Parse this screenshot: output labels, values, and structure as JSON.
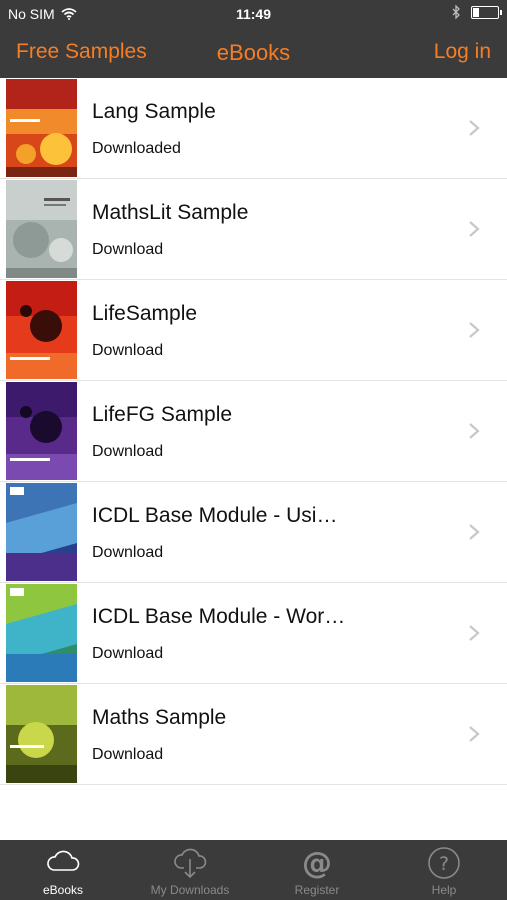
{
  "status_bar": {
    "carrier": "No SIM",
    "time": "11:49"
  },
  "nav": {
    "left_label": "Free Samples",
    "title": "eBooks",
    "right_label": "Log in"
  },
  "books": [
    {
      "title": "Lang Sample",
      "status": "Downloaded"
    },
    {
      "title": "MathsLit Sample",
      "status": "Download"
    },
    {
      "title": "LifeSample",
      "status": "Download"
    },
    {
      "title": "LifeFG Sample",
      "status": "Download"
    },
    {
      "title": "ICDL Base Module - Usi…",
      "status": "Download"
    },
    {
      "title": "ICDL Base Module - Wor…",
      "status": "Download"
    },
    {
      "title": "Maths Sample",
      "status": "Download"
    }
  ],
  "tabs": [
    {
      "label": "eBooks",
      "icon": "cloud-icon",
      "active": true
    },
    {
      "label": "My Downloads",
      "icon": "cloud-download-icon",
      "active": false
    },
    {
      "label": "Register",
      "icon": "at-icon",
      "active": false
    },
    {
      "label": "Help",
      "icon": "help-icon",
      "active": false
    }
  ],
  "colors": {
    "bar": "#3b3b3b",
    "accent": "#f57e25"
  }
}
